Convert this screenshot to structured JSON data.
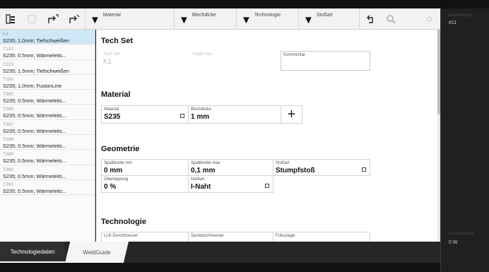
{
  "toolbar": {
    "filters": [
      {
        "label": "Material"
      },
      {
        "label": "Blechdicke"
      },
      {
        "label": "Technologie"
      },
      {
        "label": "Stoßart"
      }
    ]
  },
  "right_panel": {
    "top_label": "Bearbeitung",
    "top_value": "#11",
    "bottom_label": "Laserleistung",
    "bottom_value": "0 W"
  },
  "sidebar": {
    "items": [
      {
        "id": "K1",
        "desc": "S235; 1.0mm; Tiefschweißen"
      },
      {
        "id": "T101",
        "desc": "S235; 0.5mm; Wärmeleits..."
      },
      {
        "id": "T123",
        "desc": "S235; 1.5mm; Tiefschweißen"
      },
      {
        "id": "T180",
        "desc": "S235; 1.0mm; FusionLine"
      },
      {
        "id": "T385",
        "desc": "S235; 0.5mm; Wärmeleits..."
      },
      {
        "id": "T386",
        "desc": "S235; 0.5mm; Wärmeleits..."
      },
      {
        "id": "T387",
        "desc": "S235; 0.5mm; Wärmeleits..."
      },
      {
        "id": "T388",
        "desc": "S235; 0.5mm; Wärmeleits..."
      },
      {
        "id": "T389",
        "desc": "S235; 0.5mm; Wärmeleits..."
      },
      {
        "id": "T390",
        "desc": "S235; 0.5mm; Wärmeleits..."
      },
      {
        "id": "T391",
        "desc": "S235; 0.5mm; Wärmeleits..."
      }
    ]
  },
  "main": {
    "techset": {
      "title": "Tech Set",
      "techset_label": "Tech Set",
      "techset_value": "K1",
      "copy_label": "Kopie von",
      "comment_label": "Kommentar"
    },
    "material": {
      "title": "Material",
      "material_label": "Material",
      "material_value": "S235",
      "thickness_label": "Blechdicke",
      "thickness_value": "1 mm",
      "add_symbol": "+"
    },
    "geometrie": {
      "title": "Geometrie",
      "gap_min_label": "Spaltbreite min",
      "gap_min_value": "0 mm",
      "gap_max_label": "Spaltbreite max",
      "gap_max_value": "0,1 mm",
      "joint_label": "Stoßart",
      "joint_value": "Stumpfstoß",
      "overlap_label": "Überlappung",
      "overlap_value": "0 %",
      "seam_label": "Nahtart",
      "seam_value": "I-Naht"
    },
    "technologie": {
      "title": "Technologie",
      "llk_label": "LLK-Durchmesser",
      "spot_label": "Spotdurchmesser",
      "focus_label": "Fokuslage"
    }
  },
  "tabs": [
    {
      "label": "Technologiedaten"
    },
    {
      "label": "WeldGuide"
    }
  ]
}
